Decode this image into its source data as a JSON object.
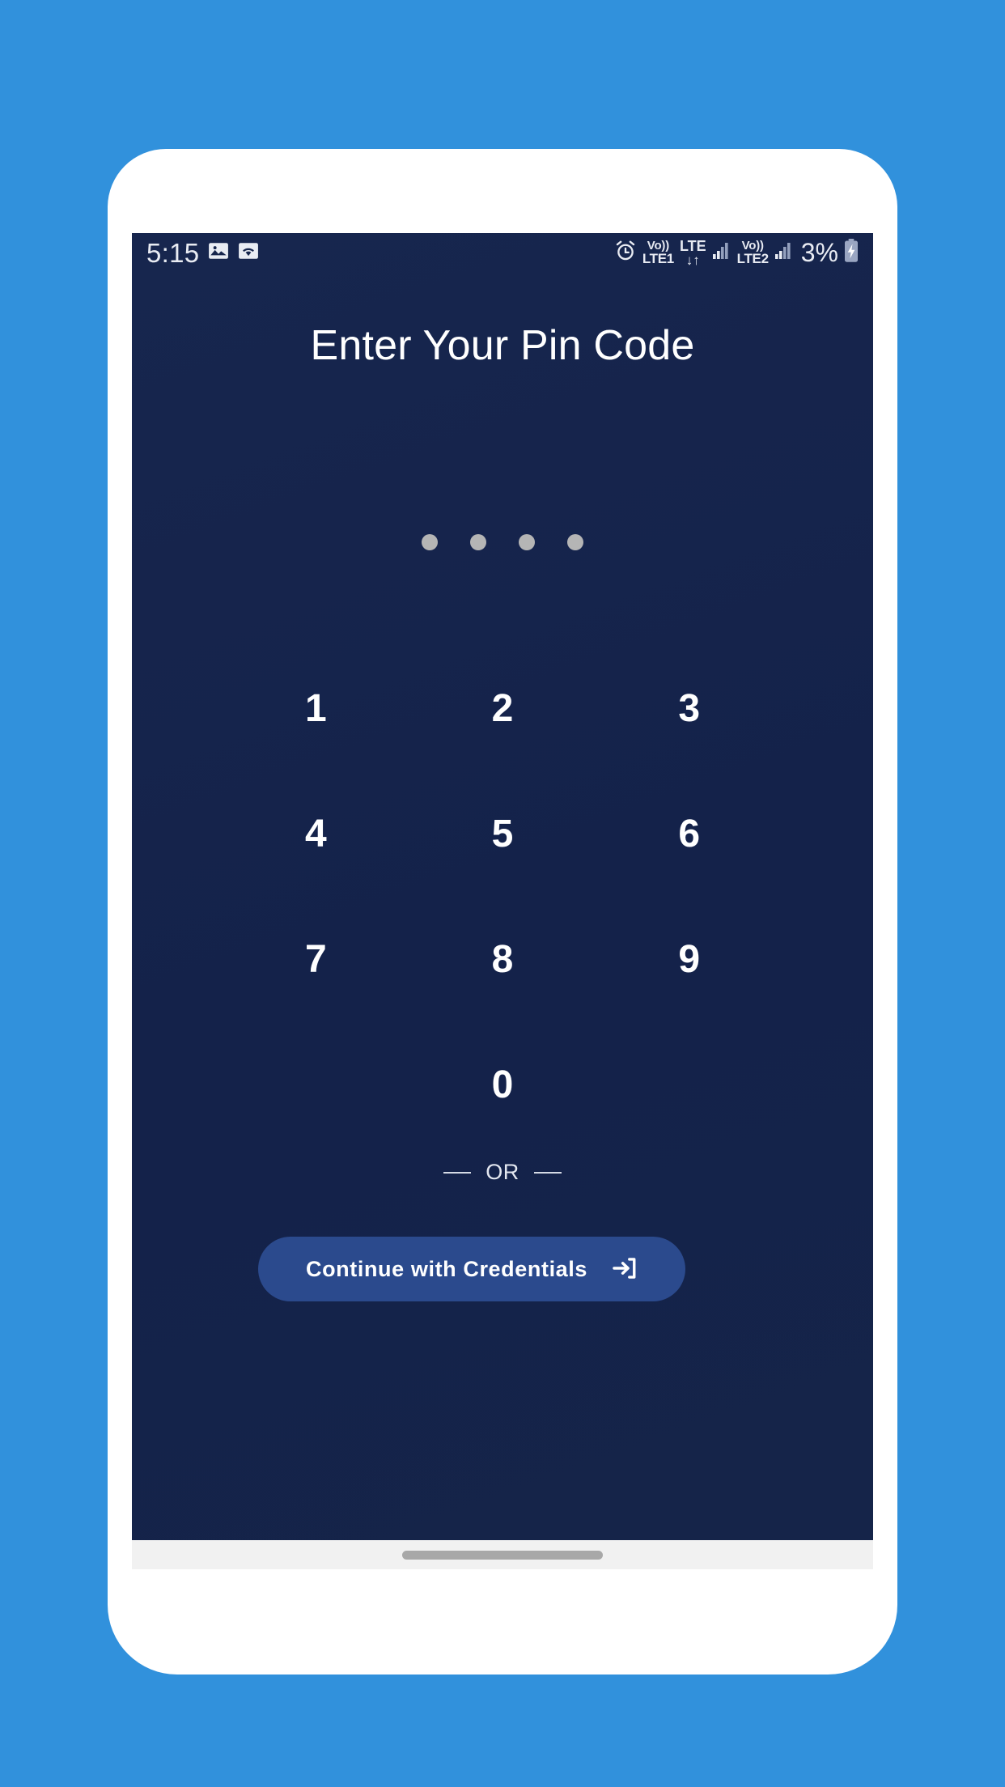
{
  "theme": {
    "page_background": "#3191dc",
    "phone_body": "#ffffff",
    "screen_background": "#16254c",
    "accent_button": "#2b4a8d",
    "pin_dot": "#b5b5b5",
    "text_primary": "#ffffff",
    "nav_bar": "#f1f1f1",
    "home_indicator": "#a8a8a8"
  },
  "status_bar": {
    "time": "5:15",
    "left_icons": [
      "photo-icon",
      "wifi-icon"
    ],
    "alarm_icon": "alarm-icon",
    "sim1": {
      "volte": "Vo))",
      "label": "LTE1"
    },
    "network": {
      "top": "LTE",
      "bottom": "↓↑"
    },
    "sim2": {
      "volte": "Vo))",
      "label": "LTE2"
    },
    "battery_percent": "3%",
    "battery_icon": "battery-charging-icon"
  },
  "screen": {
    "title": "Enter Your Pin Code",
    "pin": {
      "length": 4,
      "filled": 0,
      "dots": [
        "",
        "",
        "",
        ""
      ]
    },
    "keypad": {
      "rows": [
        [
          "1",
          "2",
          "3"
        ],
        [
          "4",
          "5",
          "6"
        ],
        [
          "7",
          "8",
          "9"
        ],
        [
          "",
          "0",
          ""
        ]
      ]
    },
    "divider": {
      "label": "OR"
    },
    "credentials_button": {
      "label": "Continue with Credentials",
      "icon": "login-arrow-icon"
    }
  },
  "nav_bar": {
    "home_indicator": "home-indicator-pill"
  }
}
